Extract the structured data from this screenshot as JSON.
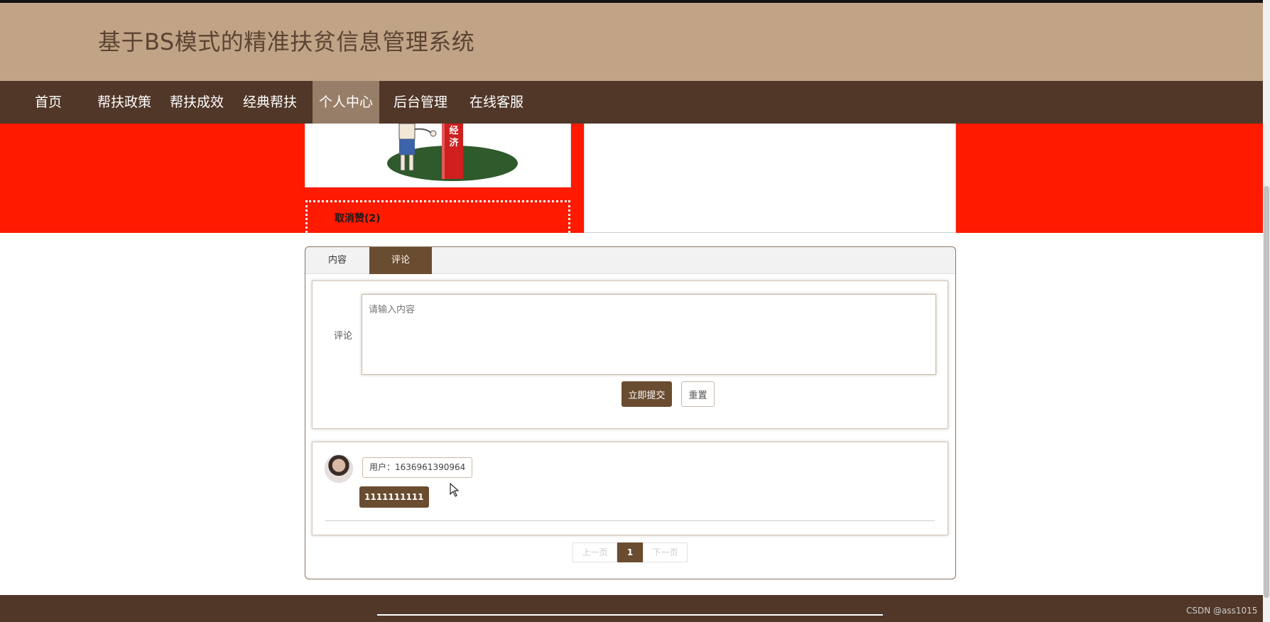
{
  "header": {
    "title": "基于BS模式的精准扶贫信息管理系统"
  },
  "nav": {
    "items": [
      {
        "label": "首页"
      },
      {
        "label": "帮扶政策"
      },
      {
        "label": "帮扶成效"
      },
      {
        "label": "经典帮扶"
      },
      {
        "label": "个人中心",
        "active": true
      },
      {
        "label": "后台管理"
      },
      {
        "label": "在线客服"
      }
    ]
  },
  "detail": {
    "image_text": "经济",
    "like_label": "取消赞(2)"
  },
  "tabs": [
    {
      "label": "内容"
    },
    {
      "label": "评论",
      "active": true
    }
  ],
  "comment_form": {
    "label": "评论",
    "placeholder": "请输入内容",
    "submit_label": "立即提交",
    "reset_label": "重置"
  },
  "comments": [
    {
      "user": "用户：1636961390964",
      "content": "1111111111"
    }
  ],
  "pager": {
    "prev": "上一页",
    "current": "1",
    "next": "下一页"
  },
  "watermark": "CSDN @ass1015",
  "colors": {
    "accent": "#6a4c30",
    "nav_bg": "#513728",
    "header_bg": "#c1a486",
    "band": "#ff1a00"
  }
}
